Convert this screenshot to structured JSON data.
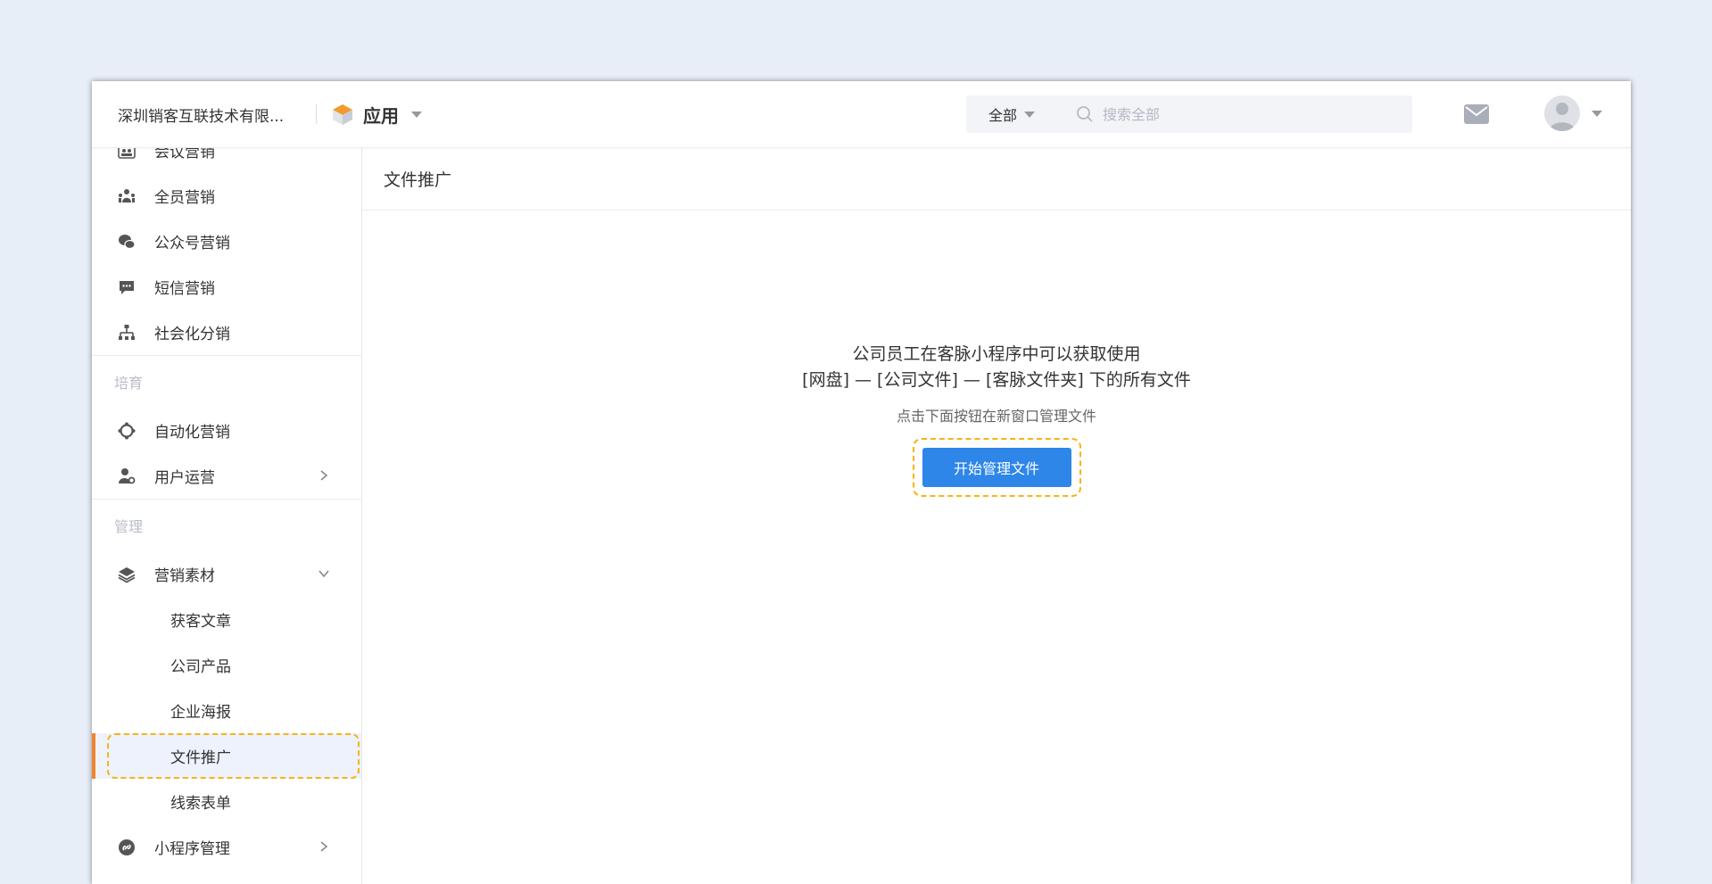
{
  "header": {
    "company": "深圳销客互联技术有限...",
    "app_label": "应用",
    "search_scope": "全部",
    "search_placeholder": "搜索全部"
  },
  "sidebar": {
    "items_top": [
      {
        "label": "会议营销",
        "icon": "meeting-icon"
      },
      {
        "label": "全员营销",
        "icon": "people-icon"
      },
      {
        "label": "公众号营销",
        "icon": "wechat-icon"
      },
      {
        "label": "短信营销",
        "icon": "sms-icon"
      },
      {
        "label": "社会化分销",
        "icon": "org-chart-icon"
      }
    ],
    "group_cultivate": "培育",
    "items_cultivate": [
      {
        "label": "自动化营销",
        "icon": "automation-icon"
      },
      {
        "label": "用户运营",
        "icon": "user-settings-icon"
      }
    ],
    "group_manage": "管理",
    "materials": {
      "label": "营销素材",
      "icon": "layers-icon"
    },
    "materials_sub": [
      "获客文章",
      "公司产品",
      "企业海报",
      "文件推广",
      "线索表单"
    ],
    "miniprogram": {
      "label": "小程序管理",
      "icon": "link-icon"
    }
  },
  "main": {
    "title": "文件推广",
    "line1": "公司员工在客脉小程序中可以获取使用",
    "line2": "[网盘] — [公司文件] — [客脉文件夹] 下的所有文件",
    "hint": "点击下面按钮在新窗口管理文件",
    "button": "开始管理文件"
  },
  "colors": {
    "accent": "#2e86e8",
    "active_indicator": "#f0852d",
    "highlight_dash": "#f5b512",
    "active_bg": "#edf2fd"
  }
}
